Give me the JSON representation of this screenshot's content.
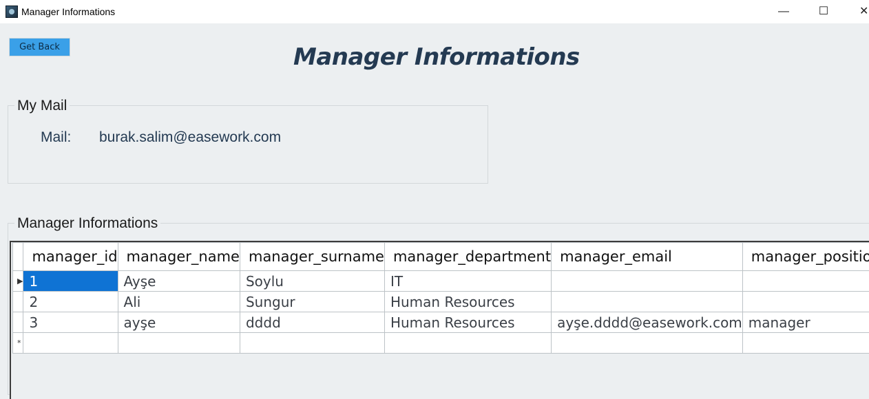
{
  "window": {
    "title": "Manager Informations",
    "minimize_glyph": "—",
    "maximize_glyph": "☐",
    "close_glyph": "✕"
  },
  "toolbar": {
    "get_back_label": "Get Back"
  },
  "page": {
    "title": "Manager Informations"
  },
  "mail_group": {
    "legend": "My Mail",
    "label": "Mail:",
    "value": "burak.salim@easework.com"
  },
  "managers_group": {
    "legend": "Manager Informations",
    "columns": [
      "manager_id",
      "manager_name",
      "manager_surname",
      "manager_department",
      "manager_email",
      "manager_position"
    ],
    "rows": [
      {
        "marker": "▶",
        "cells": [
          "1",
          "Ayşe",
          "Soylu",
          "IT",
          "",
          ""
        ]
      },
      {
        "marker": "",
        "cells": [
          "2",
          "Ali",
          "Sungur",
          "Human Resources",
          "",
          ""
        ]
      },
      {
        "marker": "",
        "cells": [
          "3",
          "ayşe",
          "dddd",
          "Human Resources",
          "ayşe.dddd@easework.com",
          "manager"
        ]
      }
    ],
    "new_row_marker": "*"
  },
  "colors": {
    "accent_button": "#3aa0e8",
    "selection": "#0f73d4",
    "title_text": "#243a52",
    "background": "#eceff1"
  }
}
